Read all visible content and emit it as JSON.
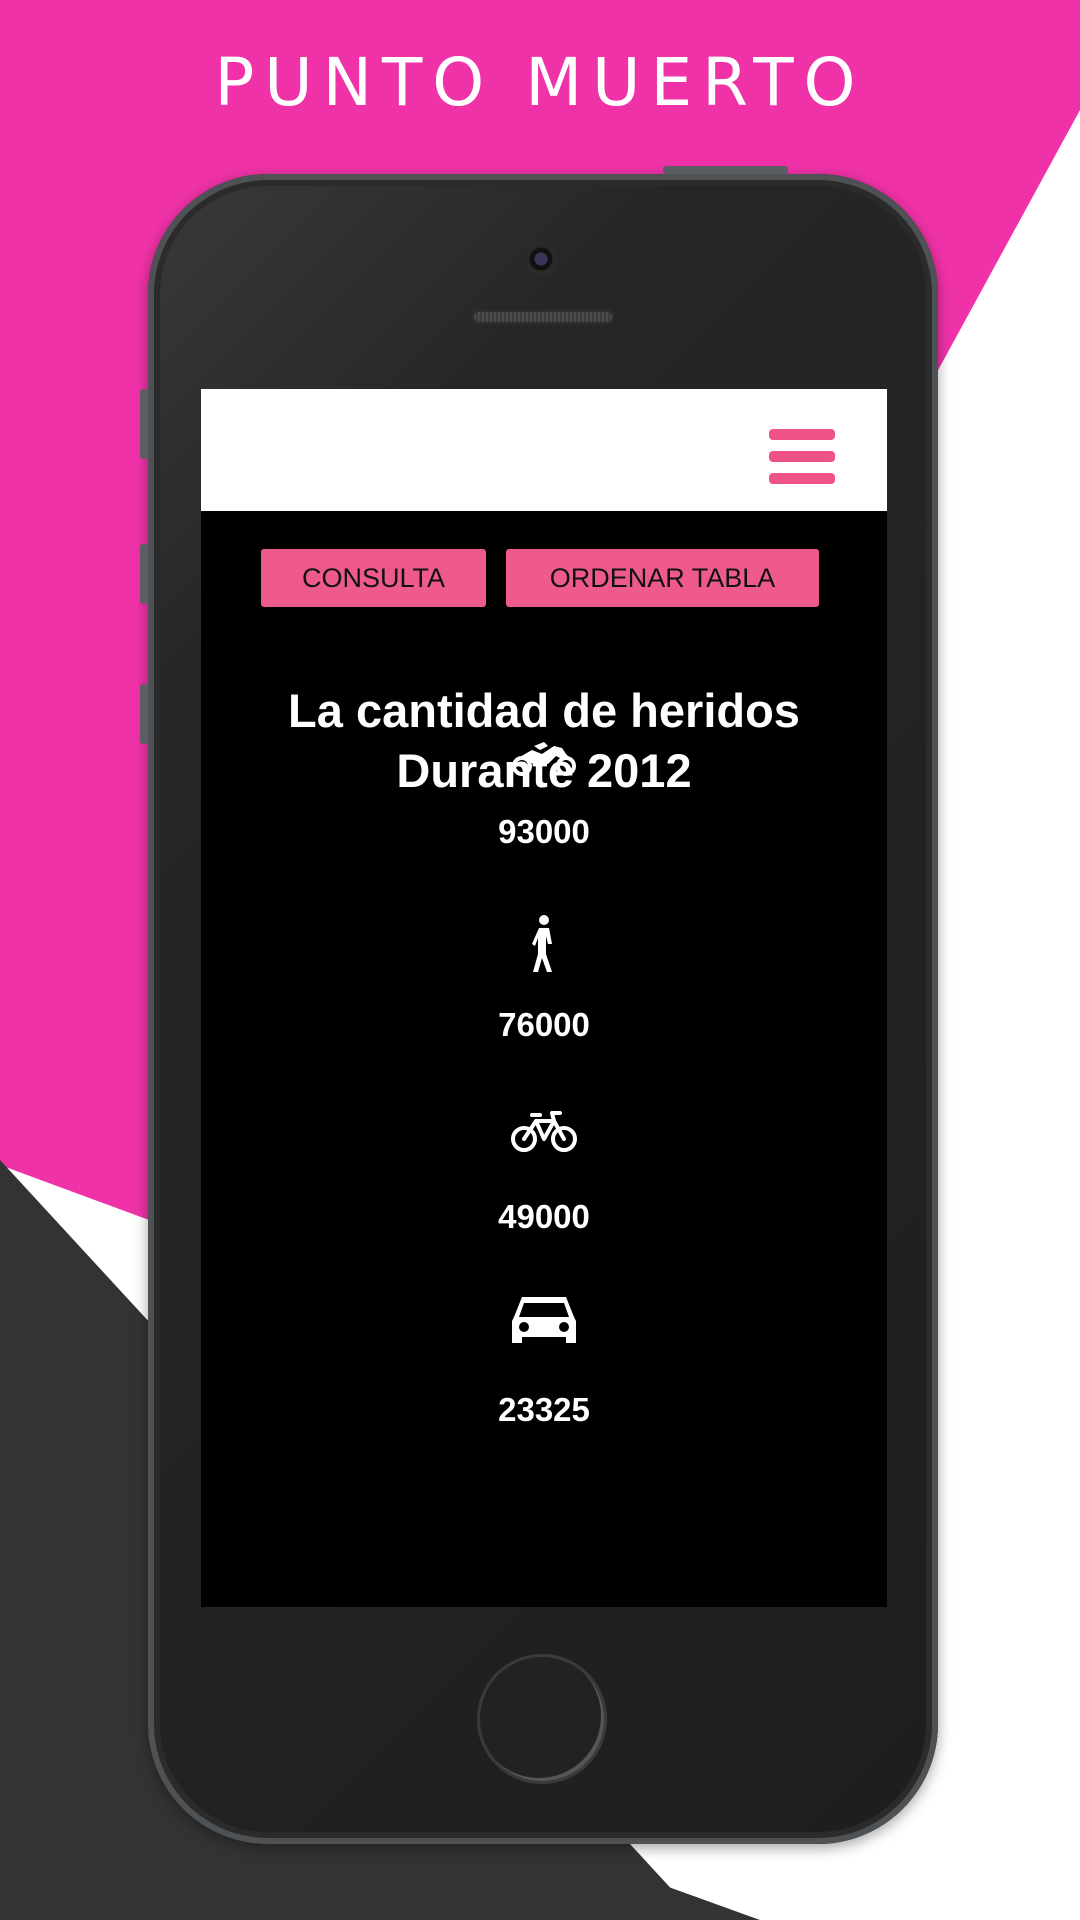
{
  "poster": {
    "title": "PUNTO MUERTO",
    "colors": {
      "accent": "#f032a8",
      "dark": "#333333",
      "background": "#ffffff"
    }
  },
  "phone": {
    "app": {
      "header": {
        "menu_icon": "hamburger-menu-icon",
        "menu_color": "#ee5289"
      },
      "toolbar": {
        "query_label": "CONSULTA",
        "sort_label": "ORDENAR TABLA",
        "button_color": "#ee5a8e"
      },
      "heading": {
        "line1": "La cantidad de heridos",
        "line2": "Durante 2012"
      },
      "stats": [
        {
          "icon": "motorcycle-icon",
          "value": "93000"
        },
        {
          "icon": "pedestrian-icon",
          "value": "76000"
        },
        {
          "icon": "bicycle-icon",
          "value": "49000"
        },
        {
          "icon": "car-icon",
          "value": "23325"
        }
      ]
    }
  }
}
